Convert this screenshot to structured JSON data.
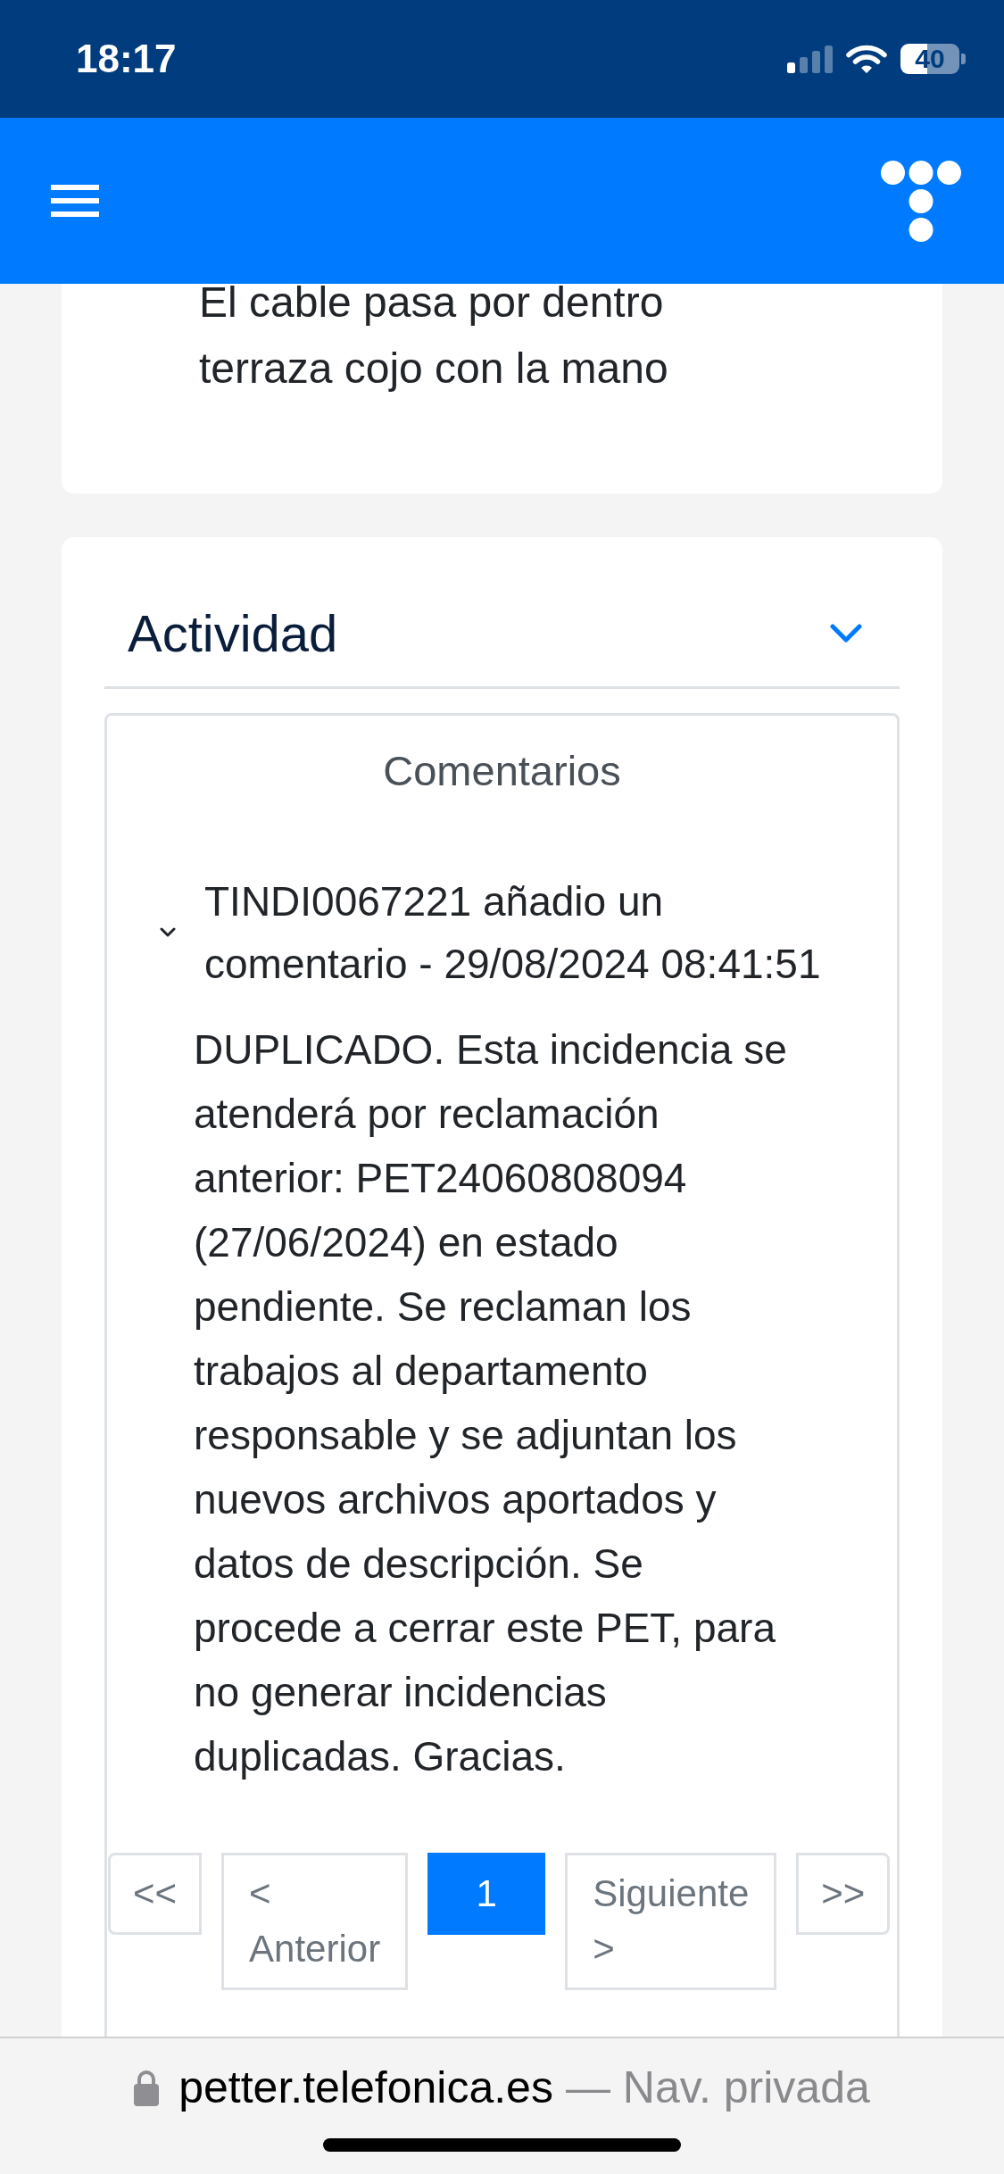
{
  "status_bar": {
    "time": "18:17",
    "battery": "40"
  },
  "description_card": {
    "text": "El cable pasa por dentro terraza cojo con la mano"
  },
  "activity": {
    "title": "Actividad",
    "expanded": true,
    "comments": {
      "title": "Comentarios",
      "items": [
        {
          "header": "TINDI0067221 añadio un comentario - 29/08/2024 08:41:51",
          "expanded": true,
          "text": "DUPLICADO. Esta incidencia se atenderá por reclamación anterior: PET24060808094 (27/06/2024) en estado pendiente. Se reclaman los trabajos al departamento responsable y se adjuntan los nuevos archivos aportados y datos de descripción. Se procede a cerrar este PET, para no generar incidencias duplicadas. Gracias."
        }
      ],
      "pagination": [
        {
          "kind": "first",
          "label": "<<",
          "selected": false
        },
        {
          "kind": "prev",
          "label": "< Anterior",
          "selected": false
        },
        {
          "kind": "page",
          "label": "1",
          "selected": true
        },
        {
          "kind": "next",
          "label": "Siguiente >",
          "selected": false
        },
        {
          "kind": "last",
          "label": ">>",
          "selected": false
        }
      ]
    }
  },
  "browser_bar": {
    "domain": "petter.telefonica.es",
    "suffix": "— Nav. privada"
  }
}
